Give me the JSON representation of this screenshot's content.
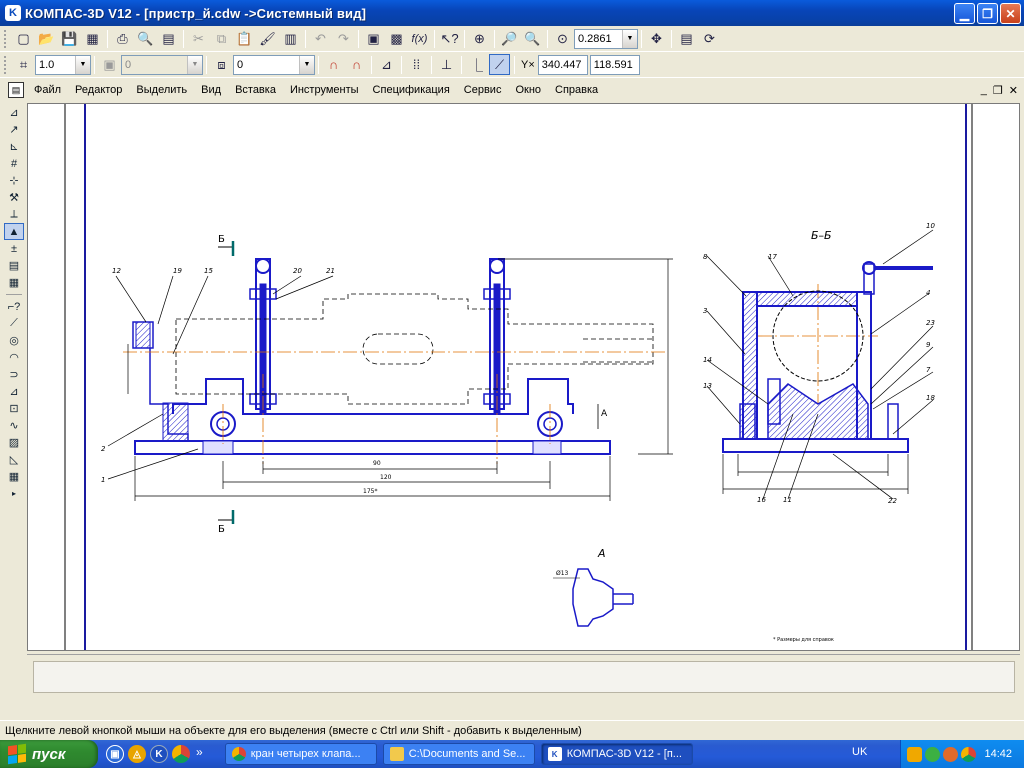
{
  "window": {
    "title": "КОМПАС-3D V12 - [пристр_й.cdw ->Системный вид]",
    "app_icon": "K"
  },
  "toolbar1": {
    "zoom_value": "0.2861"
  },
  "toolbar2": {
    "step_value": "1.0",
    "disabled_value": "0",
    "layer_value": "0",
    "coord_label": "Y×",
    "coord_x": "340.447",
    "coord_y": "118.591"
  },
  "menu": {
    "items": [
      "Файл",
      "Редактор",
      "Выделить",
      "Вид",
      "Вставка",
      "Инструменты",
      "Спецификация",
      "Сервис",
      "Окно",
      "Справка"
    ]
  },
  "status": {
    "hint": "Щелкните левой кнопкой мыши на объекте для его выделения (вместе с Ctrl или Shift - добавить к выделенным)"
  },
  "taskbar": {
    "start_label": "пуск",
    "tasks": [
      {
        "label": "кран четырех клапа...",
        "icon": "chrome-icon"
      },
      {
        "label": "C:\\Documents and Se...",
        "icon": "folder-icon"
      },
      {
        "label": "КОМПАС-3D V12 - [п...",
        "icon": "kompas-icon"
      }
    ],
    "lang": "UK",
    "clock": "14:42"
  },
  "drawing": {
    "section_label_top": "Б",
    "section_label_bottom": "Б",
    "section_title": "Б–Б",
    "view_a_label": "А",
    "view_a_title": "А",
    "callouts_main": [
      "12",
      "19",
      "15",
      "20",
      "21",
      "2",
      "1"
    ],
    "callouts_section": [
      "10",
      "8",
      "17",
      "4",
      "3",
      "23",
      "9",
      "14",
      "7",
      "13",
      "18",
      "16",
      "11",
      "22"
    ],
    "dim_view_a": "Ø13"
  }
}
